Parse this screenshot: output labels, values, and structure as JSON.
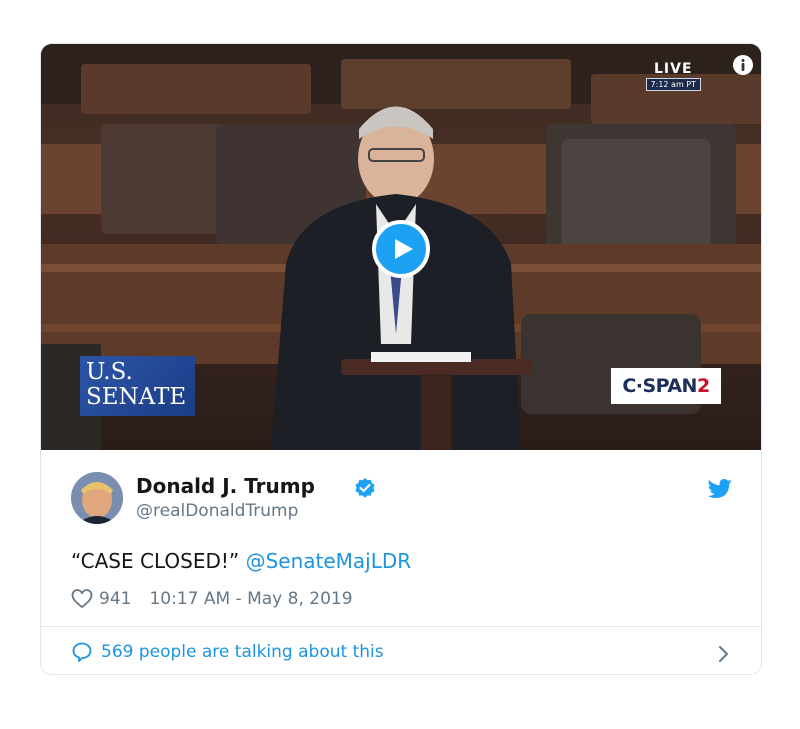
{
  "video": {
    "live_label": "LIVE",
    "live_time": "7:12 am PT",
    "senate_logo_line1": "U.S.",
    "senate_logo_line2": "SENATE",
    "network_prefix": "C·SPAN",
    "network_number": "2"
  },
  "tweet": {
    "author_name": "Donald J. Trump",
    "author_handle": "@realDonaldTrump",
    "text_quote": "“CASE CLOSED!”",
    "text_mention": "@SenateMajLDR",
    "like_count": "941",
    "timestamp": "10:17 AM - May 8, 2019",
    "talking_text": "569 people are talking about this"
  },
  "colors": {
    "accent": "#1da1f2",
    "link": "#1b95e0",
    "muted": "#657786",
    "text": "#14171a",
    "border": "#e1e8ed"
  },
  "icons": [
    "info-icon",
    "play-icon",
    "verified-badge-icon",
    "twitter-bird-icon",
    "heart-icon",
    "speech-bubble-icon",
    "chevron-right-icon"
  ]
}
